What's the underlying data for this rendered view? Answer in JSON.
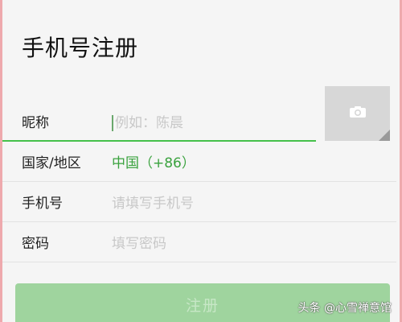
{
  "header": {
    "title": "手机号注册"
  },
  "form": {
    "nickname": {
      "label": "昵称",
      "placeholder": "例如：陈晨"
    },
    "country": {
      "label": "国家/地区",
      "value": "中国（+86）"
    },
    "phone": {
      "label": "手机号",
      "placeholder": "请填写手机号"
    },
    "password": {
      "label": "密码",
      "placeholder": "填写密码"
    }
  },
  "avatar": {
    "icon": "camera-icon"
  },
  "actions": {
    "register_label": "注册"
  },
  "watermark": {
    "text": "头条 @心雪禅意馆"
  },
  "colors": {
    "accent": "#45c04a",
    "country_value": "#3aa23e",
    "button_bg": "#9fd49e"
  }
}
